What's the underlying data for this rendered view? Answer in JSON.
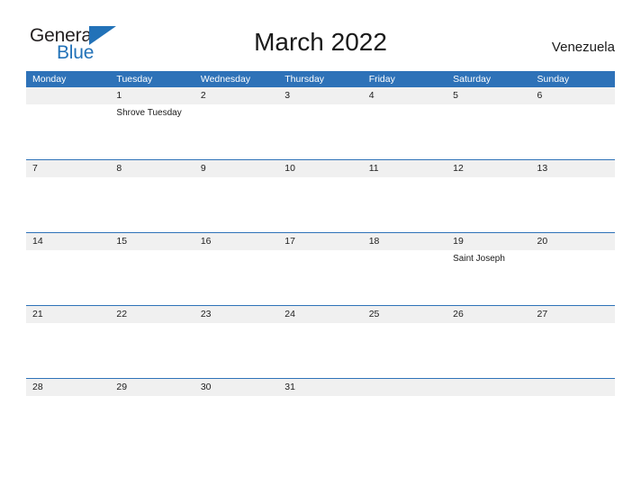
{
  "brand": {
    "name_part1": "General",
    "name_part2": "Blue",
    "flag_icon": "blue-triangle-flag-icon",
    "color_dark": "#231f20",
    "color_blue": "#2272b8"
  },
  "header": {
    "title": "March 2022",
    "region": "Venezuela"
  },
  "theme": {
    "accent_blue": "#2e72b8",
    "band_gray": "#f0f0f0",
    "text_dark": "#1a1a1a",
    "header_text": "#ffffff"
  },
  "calendar": {
    "month": "March",
    "year": "2022",
    "weekday_headers": [
      "Monday",
      "Tuesday",
      "Wednesday",
      "Thursday",
      "Friday",
      "Saturday",
      "Sunday"
    ],
    "weeks": [
      {
        "days": [
          {
            "number": "",
            "event": ""
          },
          {
            "number": "1",
            "event": "Shrove Tuesday"
          },
          {
            "number": "2",
            "event": ""
          },
          {
            "number": "3",
            "event": ""
          },
          {
            "number": "4",
            "event": ""
          },
          {
            "number": "5",
            "event": ""
          },
          {
            "number": "6",
            "event": ""
          }
        ]
      },
      {
        "days": [
          {
            "number": "7",
            "event": ""
          },
          {
            "number": "8",
            "event": ""
          },
          {
            "number": "9",
            "event": ""
          },
          {
            "number": "10",
            "event": ""
          },
          {
            "number": "11",
            "event": ""
          },
          {
            "number": "12",
            "event": ""
          },
          {
            "number": "13",
            "event": ""
          }
        ]
      },
      {
        "days": [
          {
            "number": "14",
            "event": ""
          },
          {
            "number": "15",
            "event": ""
          },
          {
            "number": "16",
            "event": ""
          },
          {
            "number": "17",
            "event": ""
          },
          {
            "number": "18",
            "event": ""
          },
          {
            "number": "19",
            "event": "Saint Joseph"
          },
          {
            "number": "20",
            "event": ""
          }
        ]
      },
      {
        "days": [
          {
            "number": "21",
            "event": ""
          },
          {
            "number": "22",
            "event": ""
          },
          {
            "number": "23",
            "event": ""
          },
          {
            "number": "24",
            "event": ""
          },
          {
            "number": "25",
            "event": ""
          },
          {
            "number": "26",
            "event": ""
          },
          {
            "number": "27",
            "event": ""
          }
        ]
      },
      {
        "days": [
          {
            "number": "28",
            "event": ""
          },
          {
            "number": "29",
            "event": ""
          },
          {
            "number": "30",
            "event": ""
          },
          {
            "number": "31",
            "event": ""
          },
          {
            "number": "",
            "event": ""
          },
          {
            "number": "",
            "event": ""
          },
          {
            "number": "",
            "event": ""
          }
        ]
      }
    ]
  }
}
